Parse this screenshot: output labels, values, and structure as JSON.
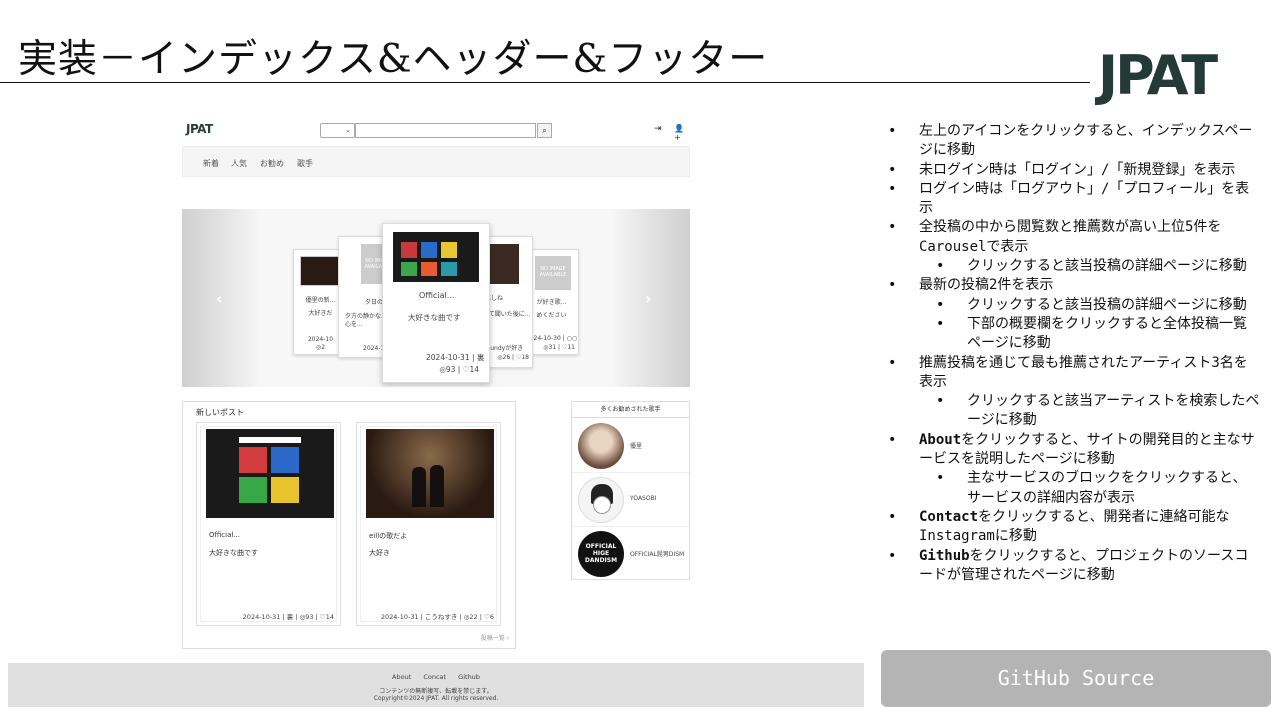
{
  "slide": {
    "title": "実装－インデックス&ヘッダー&フッター",
    "logo": "JPAT"
  },
  "site": {
    "header": {
      "logo": "JPAT",
      "search_icon": "⌕",
      "login_icon": "⇥",
      "signup_icon": "👤+"
    },
    "nav": [
      "新着",
      "人気",
      "お勧め",
      "歌手"
    ],
    "carousel": {
      "prev_arrow": "‹",
      "next_arrow": "›",
      "cards": [
        {
          "title": "優里の新...",
          "text": "大好きだ",
          "date": "2024-10",
          "stats": "◎2"
        },
        {
          "title": "夕日の中で...",
          "text": "夕方の静かな...と心を...",
          "date": "2024-1",
          "noimg": "NO IMAGE AVAILABLE"
        },
        {
          "title": "Official...",
          "text": "大好きな曲です",
          "date": "2024-10-31 | 裏",
          "views": "93",
          "likes": "14"
        },
        {
          "title": "推しね",
          "text": "って聞いた後に...",
          "date": "vaundyが好き",
          "views": "26",
          "likes": "18"
        },
        {
          "title": "が好き歌...",
          "text": "めください",
          "date": "2024-10-30 | ○○",
          "views": "31",
          "likes": "11",
          "noimg": "NO IMAGE AVAILABLE"
        }
      ]
    },
    "new_posts": {
      "title": "新しいポスト",
      "posts": [
        {
          "title": "Official...",
          "body": "大好きな曲です",
          "meta_date": "2024-10-31 | 裏 |",
          "views": "93",
          "likes": "14"
        },
        {
          "title": "eillの歌だよ",
          "body": "大好き",
          "meta_date": "2024-10-31 | こうねすき |",
          "views": "22",
          "likes": "6"
        }
      ],
      "more": "投稿一覧 ›"
    },
    "artists": {
      "title": "多くお勧めされた歌手",
      "items": [
        {
          "name": "優里"
        },
        {
          "name": "YOASOBI"
        },
        {
          "name": "OFFICIAL髭男DISM",
          "avatar_text": "OFFICIAL HIGE DANDISM"
        }
      ]
    },
    "footer": {
      "links": [
        "About",
        "Concat",
        "Github"
      ],
      "notice": "コンテンツの無断複写、転載を禁じます。",
      "copyright": "Copyright©2024 JPAT. All rights reserved."
    }
  },
  "bullets": [
    {
      "level": 1,
      "text": "左上のアイコンをクリックすると、インデックスページに移動"
    },
    {
      "level": 1,
      "text": "未ログイン時は「ログイン」/「新規登録」を表示"
    },
    {
      "level": 1,
      "text": "ログイン時は「ログアウト」/「プロフィール」を表示"
    },
    {
      "level": 1,
      "text": "全投稿の中から閲覧数と推薦数が高い上位5件をCarouselで表示"
    },
    {
      "level": 2,
      "text": "クリックすると該当投稿の詳細ページに移動"
    },
    {
      "level": 1,
      "text": "最新の投稿2件を表示"
    },
    {
      "level": 2,
      "text": "クリックすると該当投稿の詳細ページに移動"
    },
    {
      "level": 2,
      "text": "下部の概要欄をクリックすると全体投稿一覧ページに移動"
    },
    {
      "level": 1,
      "text": "推薦投稿を通じて最も推薦されたアーティスト3名を表示"
    },
    {
      "level": 2,
      "text": "クリックすると該当アーティストを検索したページに移動"
    },
    {
      "level": 1,
      "bold": "About",
      "text": "をクリックすると、サイトの開発目的と主なサービスを説明したページに移動"
    },
    {
      "level": 2,
      "text": "主なサービスのブロックをクリックすると、サービスの詳細内容が表示"
    },
    {
      "level": 1,
      "bold": "Contact",
      "text": "をクリックすると、開発者に連絡可能なInstagramに移動"
    },
    {
      "level": 1,
      "bold": "Github",
      "text": "をクリックすると、プロジェクトのソースコードが管理されたページに移動"
    }
  ],
  "github_button": "GitHub Source",
  "colors": {
    "logo": "#233a36",
    "button": "#b4b4b4",
    "footer_bg": "#e0e0e0"
  }
}
